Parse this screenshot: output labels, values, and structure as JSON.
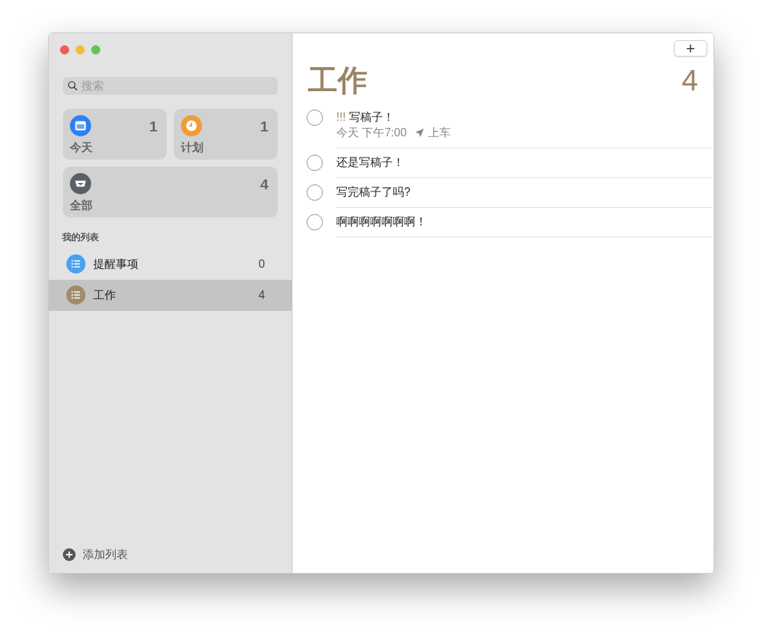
{
  "search": {
    "placeholder": "搜索"
  },
  "smart_lists": [
    {
      "kind": "today",
      "label": "今天",
      "count": "1",
      "color": "#2f7ff5"
    },
    {
      "kind": "scheduled",
      "label": "计划",
      "count": "1",
      "color": "#f29b38"
    },
    {
      "kind": "all",
      "label": "全部",
      "count": "4",
      "color": "#5b5f66"
    }
  ],
  "my_lists": {
    "heading": "我的列表",
    "items": [
      {
        "name": "提醒事项",
        "count": "0",
        "color": "#4aa0f0",
        "selected": false
      },
      {
        "name": "工作",
        "count": "4",
        "color": "#a08c6c",
        "selected": true
      }
    ]
  },
  "add_list": "添加列表",
  "add_button": "+",
  "list_title": "工作",
  "list_count": "4",
  "reminders": [
    {
      "priority": "!!!",
      "title": "写稿子！",
      "date": "今天 下午7:00",
      "location": "上车",
      "checked": false
    },
    {
      "title": "还是写稿子！",
      "checked": false
    },
    {
      "title": "写完稿子了吗?",
      "checked": false
    },
    {
      "title": "啊啊啊啊啊啊啊！",
      "checked": false
    }
  ]
}
